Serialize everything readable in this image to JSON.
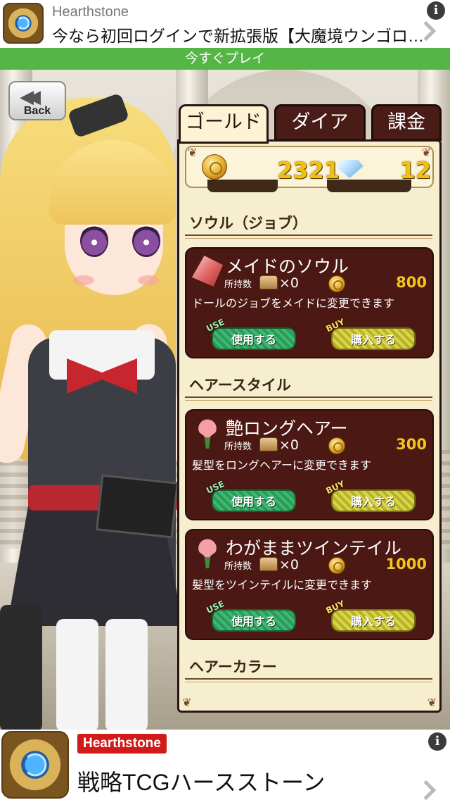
{
  "top_ad": {
    "brand": "Hearthstone",
    "headline": "今なら初回ログインで新拡張版【大魔境ウンゴロ…",
    "cta": "今すぐプレイ",
    "info": "i"
  },
  "back_button": {
    "label": "Back",
    "icon": "rewind-double-arrow-icon"
  },
  "tabs": [
    {
      "label": "ゴールド",
      "active": true
    },
    {
      "label": "ダイア",
      "active": false
    },
    {
      "label": "課金",
      "active": false
    }
  ],
  "currency": {
    "gold": "2321",
    "diamonds": "12"
  },
  "sections": [
    {
      "title": "ソウル（ジョブ）",
      "items": [
        {
          "icon": "soul-gem-icon",
          "name": "メイドのソウル",
          "owned_label": "所持数",
          "owned": "×0",
          "price": "800",
          "description": "ドールのジョブをメイドに変更できます",
          "use_tag": "USE",
          "use_label": "使用する",
          "buy_tag": "BUY",
          "buy_label": "購入する"
        }
      ]
    },
    {
      "title": "ヘアースタイル",
      "items": [
        {
          "icon": "flower-icon",
          "name": "艶ロングヘアー",
          "owned_label": "所持数",
          "owned": "×0",
          "price": "300",
          "description": "髪型をロングヘアーに変更できます",
          "use_tag": "USE",
          "use_label": "使用する",
          "buy_tag": "BUY",
          "buy_label": "購入する"
        },
        {
          "icon": "flower-icon",
          "name": "わがままツインテイル",
          "owned_label": "所持数",
          "owned": "×0",
          "price": "1000",
          "description": "髪型をツインテイルに変更できます",
          "use_tag": "USE",
          "use_label": "使用する",
          "buy_tag": "BUY",
          "buy_label": "購入する"
        }
      ]
    },
    {
      "title": "ヘアーカラー",
      "items": []
    }
  ],
  "bottom_ad": {
    "brand": "Hearthstone",
    "headline": "戦略TCGハースストーン",
    "info": "i"
  },
  "colors": {
    "ad_cta_green": "#55b646",
    "panel_bg": "#f6efcf",
    "item_bg": "#4b1814",
    "price_gold": "#f3c51d",
    "use_green": "#3fb872",
    "buy_yellow": "#d9d64a"
  }
}
